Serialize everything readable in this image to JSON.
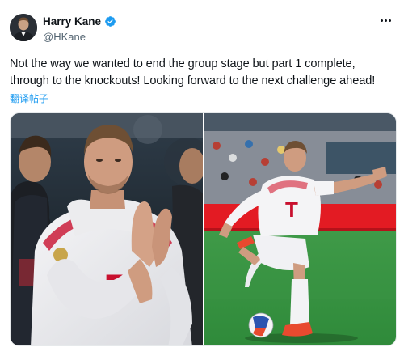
{
  "user": {
    "display_name": "Harry Kane",
    "handle": "@HKane",
    "avatar_icon": "avatar-photo",
    "verified_icon": "verified-badge-icon",
    "verified_color": "#1d9bf0"
  },
  "tweet": {
    "text": "Not the way we wanted to end the group stage but part 1 complete, through to the knockouts! Looking forward to the next challenge ahead!",
    "translate_label": "翻译帖子"
  },
  "media": {
    "jersey_logo": "T",
    "images": [
      {
        "icon": "player-applauding-photo"
      },
      {
        "icon": "player-kicking-ball-photo"
      }
    ]
  },
  "colors": {
    "link": "#1d9bf0",
    "text": "#0f1419",
    "secondary": "#536471"
  }
}
